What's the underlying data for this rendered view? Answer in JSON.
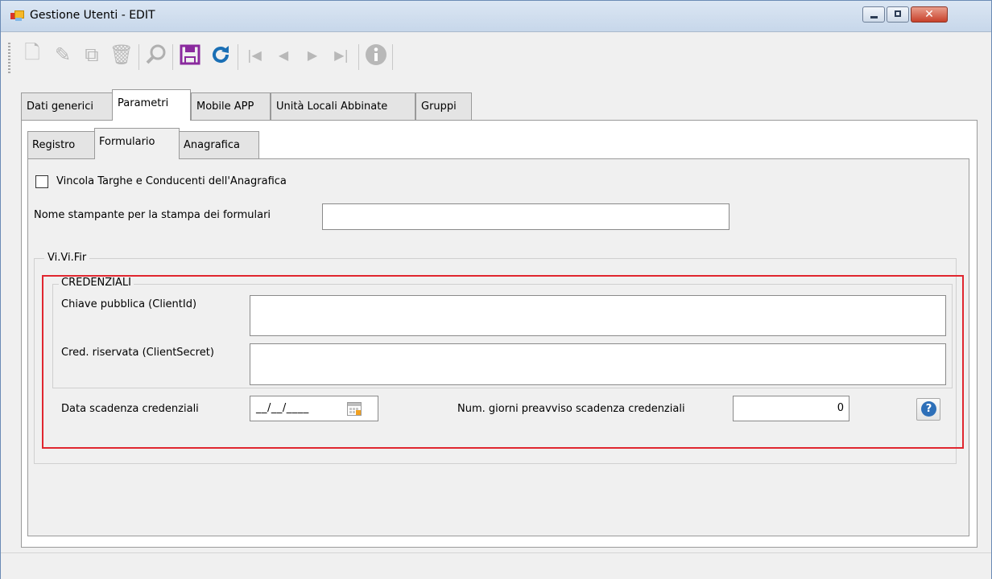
{
  "window": {
    "title": "Gestione Utenti - EDIT"
  },
  "toolbar": {
    "new": "🗋",
    "edit": "✎",
    "copy": "⧉",
    "delete": "🗑",
    "search": "⚲",
    "save": "💾",
    "refresh": "↻",
    "first": "|◀",
    "prev": "◀",
    "next": "▶",
    "last": "▶|",
    "info": "ⓘ"
  },
  "tabs": [
    "Dati generici",
    "Parametri",
    "Mobile APP",
    "Unità Locali Abbinate",
    "Gruppi"
  ],
  "subtabs": [
    "Registro",
    "Formulario",
    "Anagrafica"
  ],
  "form": {
    "vincola_label": "Vincola Targhe e Conducenti dell'Anagrafica",
    "stampante_label": "Nome stampante per la stampa dei formulari",
    "stampante_value": "",
    "vivifir_group": "Vi.Vi.Fir",
    "credenziali_group": "CREDENZIALI",
    "client_id_label": "Chiave pubblica (ClientId)",
    "client_id_value": "",
    "client_secret_label": "Cred. riservata (ClientSecret)",
    "client_secret_value": "",
    "data_scadenza_label": "Data scadenza credenziali",
    "data_scadenza_value": "__/__/____",
    "num_giorni_label": "Num. giorni preavviso scadenza credenziali",
    "num_giorni_value": "0",
    "help": "?"
  }
}
